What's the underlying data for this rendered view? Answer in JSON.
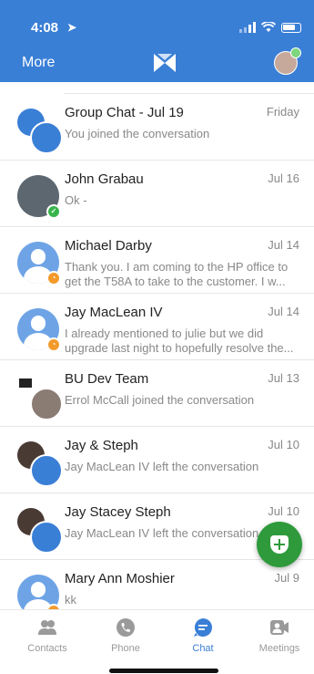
{
  "status": {
    "time": "4:08"
  },
  "nav": {
    "more_label": "More"
  },
  "chats": [
    {
      "name": "Group Chat - Jul 19",
      "date": "Friday",
      "preview": "You joined the conversation"
    },
    {
      "name": "John Grabau",
      "date": "Jul 16",
      "preview": "Ok -"
    },
    {
      "name": "Michael Darby",
      "date": "Jul 14",
      "preview": "Thank you.  I am coming to the HP office to get the T58A to take to the customer.  I w..."
    },
    {
      "name": "Jay MacLean IV",
      "date": "Jul 14",
      "preview": "I already mentioned to julie but we did upgrade last night to hopefully resolve the..."
    },
    {
      "name": "BU Dev Team",
      "date": "Jul 13",
      "preview": "Errol McCall joined the conversation"
    },
    {
      "name": "Jay & Steph",
      "date": "Jul 10",
      "preview": "Jay MacLean IV left the conversation"
    },
    {
      "name": "Jay Stacey Steph",
      "date": "Jul 10",
      "preview": "Jay MacLean IV left the conversation"
    },
    {
      "name": "Mary Ann Moshier",
      "date": "Jul 9",
      "preview": "kk"
    }
  ],
  "tabs": [
    {
      "label": "Contacts",
      "icon": "contacts-icon"
    },
    {
      "label": "Phone",
      "icon": "phone-icon"
    },
    {
      "label": "Chat",
      "icon": "chat-icon"
    },
    {
      "label": "Meetings",
      "icon": "meetings-icon"
    }
  ],
  "colors": {
    "brand": "#3a7fd6",
    "fab": "#2e9a3b",
    "online": "#38b44a",
    "away": "#f39a2a"
  }
}
